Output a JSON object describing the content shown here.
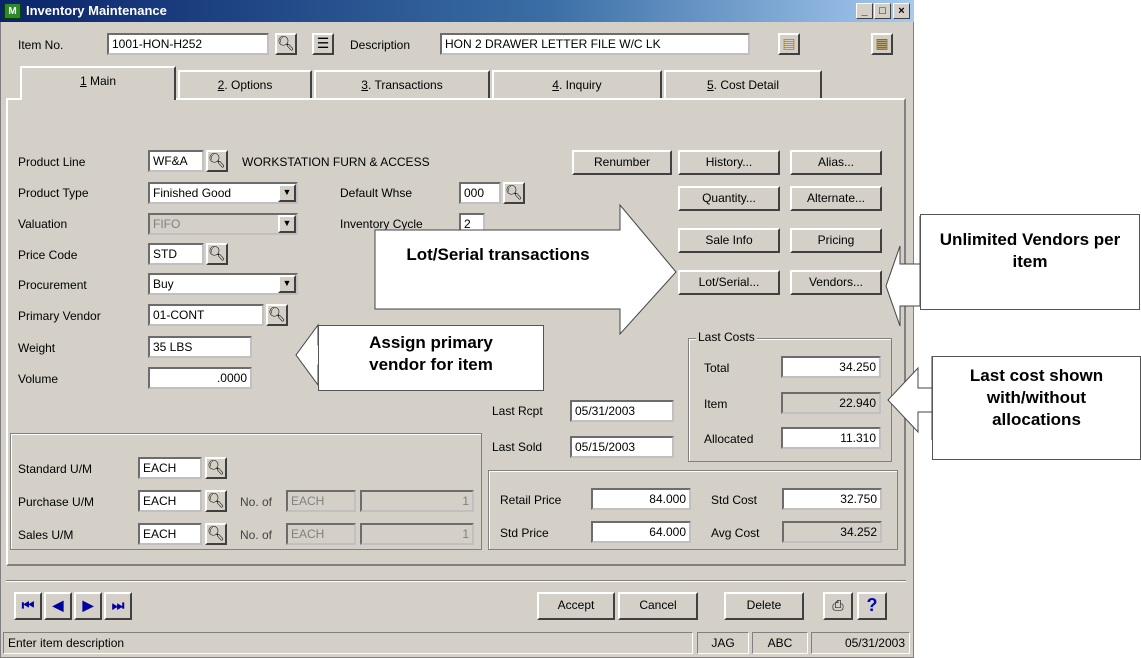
{
  "window": {
    "title": "Inventory Maintenance",
    "app_icon": "M",
    "controls": [
      "_",
      "□",
      "×"
    ]
  },
  "header": {
    "item_no_label": "Item No.",
    "item_no": "1001-HON-H252",
    "description_label": "Description",
    "description": "HON 2 DRAWER LETTER FILE W/C LK"
  },
  "tabs": [
    {
      "num": "1",
      "label": "Main"
    },
    {
      "num": "2",
      "label": "Options"
    },
    {
      "num": "3",
      "label": "Transactions"
    },
    {
      "num": "4",
      "label": "Inquiry"
    },
    {
      "num": "5",
      "label": "Cost Detail"
    }
  ],
  "main": {
    "product_line_label": "Product Line",
    "product_line": "WF&A",
    "product_line_desc": "WORKSTATION FURN & ACCESS",
    "product_type_label": "Product Type",
    "product_type": "Finished Good",
    "default_whse_label": "Default Whse",
    "default_whse": "000",
    "valuation_label": "Valuation",
    "valuation": "FIFO",
    "inventory_cycle_label": "Inventory Cycle",
    "inventory_cycle": "2",
    "price_code_label": "Price Code",
    "price_code": "STD",
    "procurement_label": "Procurement",
    "procurement": "Buy",
    "primary_vendor_label": "Primary Vendor",
    "primary_vendor": "01-CONT",
    "weight_label": "Weight",
    "weight": "35 LBS",
    "volume_label": "Volume",
    "volume": ".0000",
    "last_rcpt_label": "Last Rcpt",
    "last_rcpt": "05/31/2003",
    "last_sold_label": "Last Sold",
    "last_sold": "05/15/2003",
    "std_um_label": "Standard U/M",
    "std_um": "EACH",
    "purchase_um_label": "Purchase U/M",
    "purchase_um": "EACH",
    "purchase_noof_label": "No. of",
    "purchase_noof": "EACH",
    "purchase_qty": "1",
    "sales_um_label": "Sales U/M",
    "sales_um": "EACH",
    "sales_noof_label": "No. of",
    "sales_noof": "EACH",
    "sales_qty": "1",
    "retail_price_label": "Retail Price",
    "retail_price": "84.000",
    "std_price_label": "Std Price",
    "std_price": "64.000",
    "std_cost_label": "Std Cost",
    "std_cost": "32.750",
    "avg_cost_label": "Avg Cost",
    "avg_cost": "34.252"
  },
  "buttons": {
    "renumber": "Renumber",
    "history": "History...",
    "alias": "Alias...",
    "quantity": "Quantity...",
    "alternate": "Alternate...",
    "sale_info": "Sale Info",
    "pricing": "Pricing",
    "lot_serial": "Lot/Serial...",
    "vendors": "Vendors..."
  },
  "last_costs": {
    "title": "Last Costs",
    "total_label": "Total",
    "total": "34.250",
    "item_label": "Item",
    "item": "22.940",
    "allocated_label": "Allocated",
    "allocated": "11.310"
  },
  "footer": {
    "accept": "Accept",
    "cancel": "Cancel",
    "delete": "Delete"
  },
  "status": {
    "message": "Enter item description",
    "user": "JAG",
    "company": "ABC",
    "date": "05/31/2003"
  },
  "callouts": {
    "lot_serial": "Lot/Serial transactions",
    "vendors": "Unlimited Vendors per item",
    "primary_vendor": "Assign primary vendor for item",
    "last_cost": "Last cost shown with/without allocations"
  }
}
